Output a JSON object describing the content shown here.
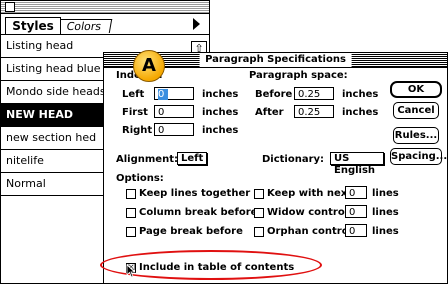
{
  "palette": {
    "tabs": [
      "Styles",
      "Colors"
    ],
    "styles": [
      "Listing head",
      "Listing head blue",
      "Mondo side heads",
      "NEW HEAD",
      "new section hed",
      "nitelife",
      "Normal"
    ],
    "selected_index": 3
  },
  "callout": {
    "label": "A"
  },
  "dialog": {
    "title": "Paragraph Specifications",
    "indents_label": "Indents:",
    "left_label": "Left",
    "left_value": "0",
    "first_label": "First",
    "first_value": "0",
    "right_label": "Right",
    "right_value": "0",
    "unit": "inches",
    "paragraph_space_label": "Paragraph space:",
    "before_label": "Before",
    "before_value": "0.25",
    "after_label": "After",
    "after_value": "0.25",
    "alignment_label": "Alignment:",
    "alignment_value": "Left",
    "dictionary_label": "Dictionary:",
    "dictionary_value": "US English",
    "options_label": "Options:",
    "keep_lines_together": "Keep lines together",
    "keep_with_next": "Keep with next",
    "keep_with_next_value": "0",
    "column_break_before": "Column break before",
    "widow_control": "Widow control",
    "widow_value": "0",
    "page_break_before": "Page break before",
    "orphan_control": "Orphan control",
    "orphan_value": "0",
    "lines_unit": "lines",
    "include_in_toc": "Include in table of contents",
    "include_in_toc_checked": "☒",
    "buttons": {
      "ok": "OK",
      "cancel": "Cancel",
      "rules": "Rules...",
      "spacing": "Spacing..."
    }
  },
  "colors": {
    "highlight": "#e01010",
    "badge": "#f5a800",
    "selection": "#3b8fe0"
  }
}
